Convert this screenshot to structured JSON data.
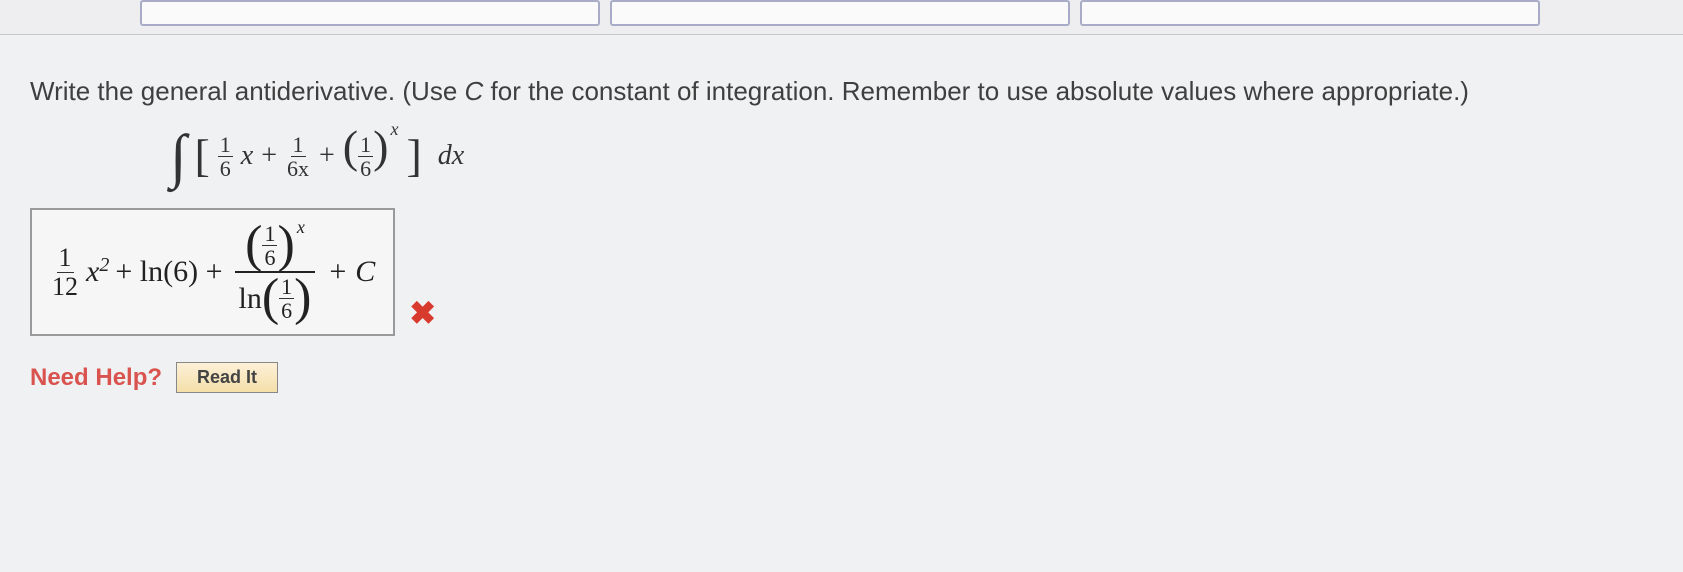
{
  "prompt": {
    "text_a": "Write the general antiderivative. (Use ",
    "const_var": "C",
    "text_b": " for the constant of integration. Remember to use absolute values where appropriate.)"
  },
  "integral": {
    "f1_num": "1",
    "f1_den": "6",
    "var1": "x",
    "plus1": "+",
    "f2_num": "1",
    "f2_den": "6x",
    "plus2": "+",
    "f3_num": "1",
    "f3_den": "6",
    "exp": "x",
    "dx": "dx"
  },
  "answer": {
    "a_num": "1",
    "a_den": "12",
    "x2": "x",
    "sq": "2",
    "plus1": "+ ln(6) +",
    "top_inner_num": "1",
    "top_inner_den": "6",
    "top_exp": "x",
    "bot_ln": "ln",
    "bot_inner_num": "1",
    "bot_inner_den": "6",
    "tail": "+ C"
  },
  "status": {
    "mark": "✖"
  },
  "help": {
    "label": "Need Help?",
    "button": "Read It"
  }
}
